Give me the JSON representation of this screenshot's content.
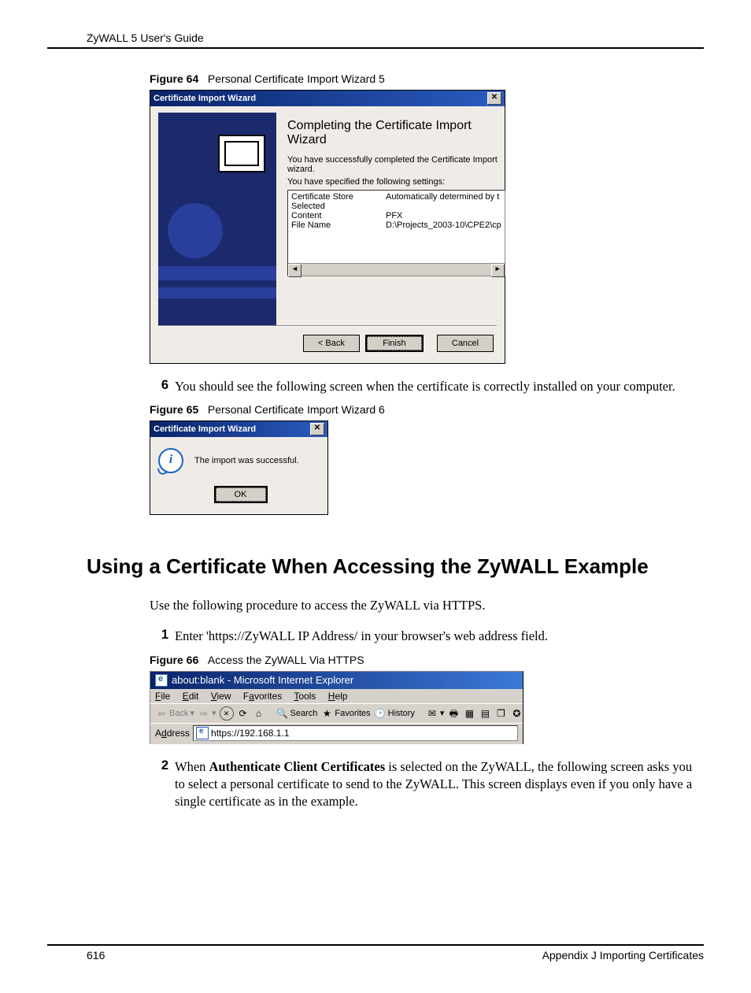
{
  "header": "ZyWALL 5 User's Guide",
  "fig64": {
    "label": "Figure 64",
    "title": "Personal Certificate Import Wizard 5"
  },
  "wizard5": {
    "title": "Certificate Import Wizard",
    "heading": "Completing the Certificate Import Wizard",
    "body1": "You have successfully completed the Certificate Import wizard.",
    "body2": "You have specified the following settings:",
    "rows": [
      {
        "k": "Certificate Store Selected",
        "v": "Automatically determined by t"
      },
      {
        "k": "Content",
        "v": "PFX"
      },
      {
        "k": "File Name",
        "v": "D:\\Projects_2003-10\\CPE2\\cp"
      }
    ],
    "back": "< Back",
    "finish": "Finish",
    "cancel": "Cancel"
  },
  "step6": {
    "num": "6",
    "text": "You should see the following screen when the certificate is correctly installed on your computer."
  },
  "fig65": {
    "label": "Figure 65",
    "title": "Personal Certificate Import Wizard 6"
  },
  "wizard6": {
    "title": "Certificate Import Wizard",
    "msg": "The import was successful.",
    "ok": "OK"
  },
  "section": "Using a Certificate When Accessing the ZyWALL Example",
  "paragraph": "Use the following procedure to access the ZyWALL via HTTPS.",
  "step1": {
    "num": "1",
    "text": "Enter 'https://ZyWALL IP Address/ in your browser's web address field."
  },
  "fig66": {
    "label": "Figure 66",
    "title": "Access the ZyWALL Via HTTPS"
  },
  "ie": {
    "title": "about:blank - Microsoft Internet Explorer",
    "menu": {
      "file": "File",
      "edit": "Edit",
      "view": "View",
      "favorites": "Favorites",
      "tools": "Tools",
      "help": "Help"
    },
    "toolbar": {
      "back": "Back",
      "search": "Search",
      "favorites": "Favorites",
      "history": "History"
    },
    "address_label": "Address",
    "address_value": "https://192.168.1.1"
  },
  "step2": {
    "num": "2",
    "text_pre": "When ",
    "text_bold": "Authenticate Client Certificates",
    "text_post": " is selected on the ZyWALL, the following screen asks you to select a personal certificate to send to the ZyWALL. This screen displays even if you only have a single certificate as in the example."
  },
  "footer": {
    "page": "616",
    "right": "Appendix J Importing Certificates"
  }
}
